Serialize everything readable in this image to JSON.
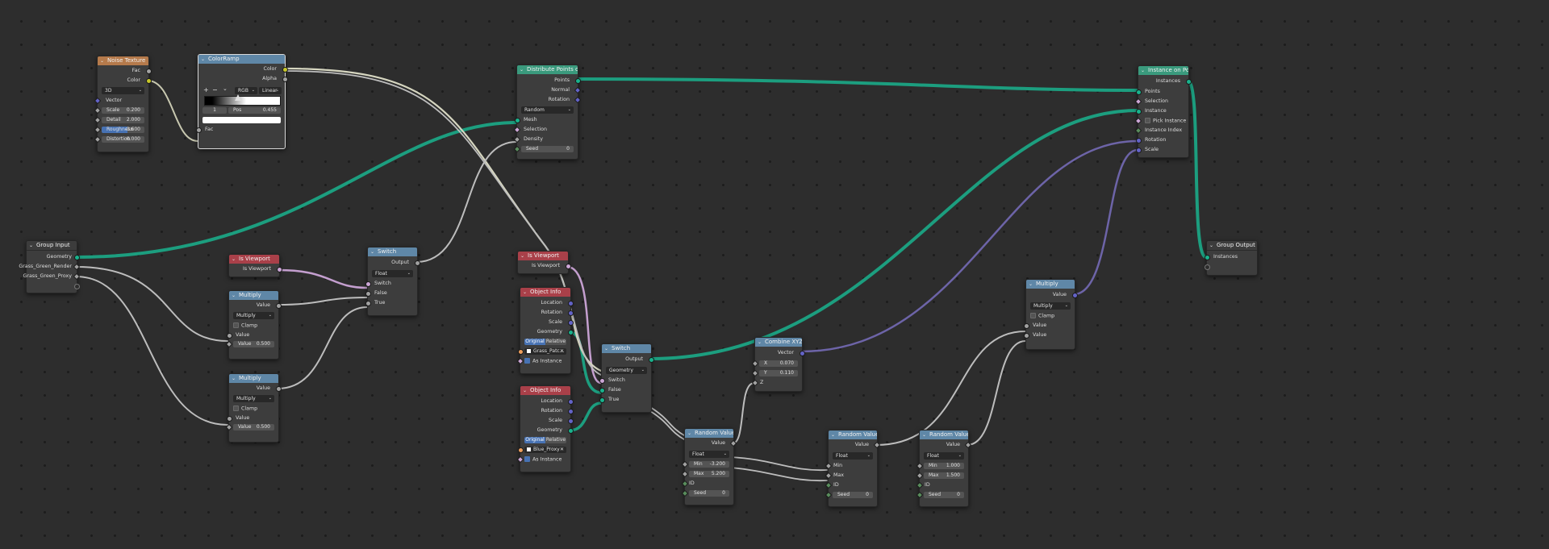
{
  "colors": {
    "geometry_socket": "#19b28c",
    "float_socket": "#a1a1a1",
    "vector_socket": "#6363c7",
    "color_socket": "#c7c729",
    "boolean_socket": "#cca6d6",
    "texture_header": "#b57a4b",
    "converter_header": "#5f87a7",
    "geometry_header": "#3a9a7d",
    "input_header": "#a94049"
  },
  "nodes": {
    "noise_texture": {
      "title": "Noise Texture",
      "outputs": [
        "Fac",
        "Color"
      ],
      "dimensions": "3D",
      "vector_label": "Vector",
      "fields": [
        {
          "label": "Scale",
          "value": "0.200"
        },
        {
          "label": "Detail",
          "value": "2.000"
        },
        {
          "label": "Roughness",
          "value": "0.600"
        },
        {
          "label": "Distortion",
          "value": "0.000"
        }
      ]
    },
    "color_ramp": {
      "title": "ColorRamp",
      "outputs": [
        "Color",
        "Alpha"
      ],
      "plus": "+",
      "minus": "−",
      "menu": "⌄",
      "color_mode": "RGB",
      "interpolation": "Linear",
      "stop_index": "1",
      "pos_label": "Pos",
      "pos_value": "0.455",
      "stop_position": 0.455,
      "input": "Fac"
    },
    "group_input": {
      "title": "Group Input",
      "outputs": [
        "Geometry",
        "Grass_Green_Render",
        "Grass_Green_Proxy"
      ]
    },
    "is_viewport_1": {
      "title": "Is Viewport",
      "output": "Is Viewport"
    },
    "multiply_1": {
      "title": "Multiply",
      "output": "Value",
      "operation": "Multiply",
      "clamp": "Clamp",
      "input": "Value",
      "field_label": "Value",
      "field_value": "0.500"
    },
    "multiply_2": {
      "title": "Multiply",
      "output": "Value",
      "operation": "Multiply",
      "clamp": "Clamp",
      "input": "Value",
      "field_label": "Value",
      "field_value": "0.500"
    },
    "switch_1": {
      "title": "Switch",
      "output": "Output",
      "type": "Float",
      "inputs": [
        "Switch",
        "False",
        "True"
      ]
    },
    "distribute_points": {
      "title": "Distribute Points on Faces",
      "outputs": [
        "Points",
        "Normal",
        "Rotation"
      ],
      "mode": "Random",
      "inputs": [
        "Mesh",
        "Selection",
        "Density"
      ],
      "seed_label": "Seed",
      "seed_value": "0"
    },
    "is_viewport_2": {
      "title": "Is Viewport",
      "output": "Is Viewport"
    },
    "object_info_1": {
      "title": "Object Info",
      "outputs": [
        "Location",
        "Rotation",
        "Scale",
        "Geometry"
      ],
      "original": "Original",
      "relative": "Relative",
      "object": "Grass_Patc...",
      "as_instance": "As Instance"
    },
    "object_info_2": {
      "title": "Object Info",
      "outputs": [
        "Location",
        "Rotation",
        "Scale",
        "Geometry"
      ],
      "original": "Original",
      "relative": "Relative",
      "object": "Blue_Proxy",
      "as_instance": "As Instance"
    },
    "switch_2": {
      "title": "Switch",
      "output": "Output",
      "type": "Geometry",
      "inputs": [
        "Switch",
        "False",
        "True"
      ]
    },
    "random_value_1": {
      "title": "Random Value",
      "output": "Value",
      "type": "Float",
      "min_label": "Min",
      "min_value": "-3.200",
      "max_label": "Max",
      "max_value": "5.200",
      "id_label": "ID",
      "seed_label": "Seed",
      "seed_value": "0"
    },
    "combine_xyz": {
      "title": "Combine XYZ",
      "output": "Vector",
      "x_label": "X",
      "x_value": "0.070",
      "y_label": "Y",
      "y_value": "0.110",
      "z_label": "Z"
    },
    "random_value_2": {
      "title": "Random Value",
      "output": "Value",
      "type": "Float",
      "inputs": [
        "Min",
        "Max",
        "ID"
      ],
      "seed_label": "Seed",
      "seed_value": "0"
    },
    "random_value_3": {
      "title": "Random Value",
      "output": "Value",
      "type": "Float",
      "min_label": "Min",
      "min_value": "1.000",
      "max_label": "Max",
      "max_value": "1.500",
      "id_label": "ID",
      "seed_label": "Seed",
      "seed_value": "0"
    },
    "multiply_3": {
      "title": "Multiply",
      "output": "Value",
      "operation": "Multiply",
      "clamp": "Clamp",
      "inputs": [
        "Value",
        "Value"
      ]
    },
    "instance_on_points": {
      "title": "Instance on Points",
      "output": "Instances",
      "inputs": [
        "Points",
        "Selection",
        "Instance"
      ],
      "pick_instance": "Pick Instance",
      "inputs_after": [
        "Instance Index",
        "Rotation",
        "Scale"
      ]
    },
    "group_output": {
      "title": "Group Output",
      "input": "Instances"
    }
  }
}
